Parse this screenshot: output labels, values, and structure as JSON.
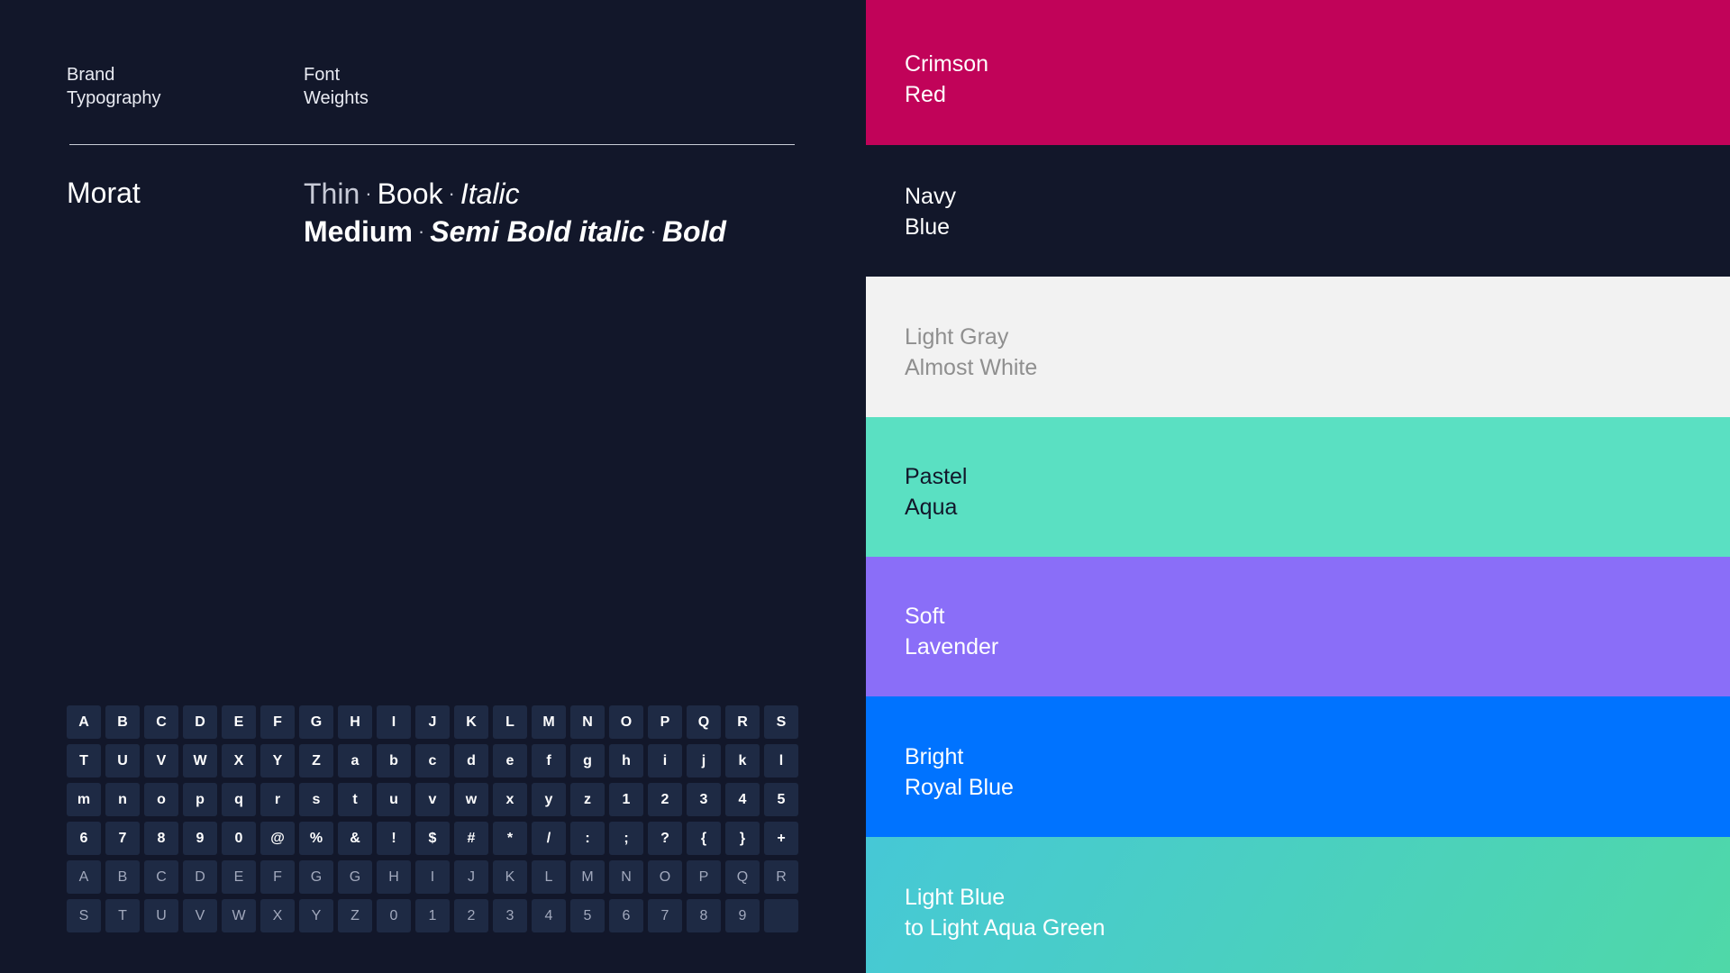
{
  "header": {
    "brand_line1": "Brand",
    "brand_line2": "Typography",
    "font_line1": "Font",
    "font_line2": "Weights"
  },
  "font_name": "Morat",
  "weights": {
    "thin": "Thin",
    "book": "Book",
    "italic": "Italic",
    "medium": "Medium",
    "semibold_italic": "Semi Bold italic",
    "bold": "Bold",
    "separator": "·"
  },
  "glyphs_bold": [
    "A",
    "B",
    "C",
    "D",
    "E",
    "F",
    "G",
    "H",
    "I",
    "J",
    "K",
    "L",
    "M",
    "N",
    "O",
    "P",
    "Q",
    "R",
    "S",
    "T",
    "U",
    "V",
    "W",
    "X",
    "Y",
    "Z",
    "a",
    "b",
    "c",
    "d",
    "e",
    "f",
    "g",
    "h",
    "i",
    "j",
    "k",
    "l",
    "m",
    "n",
    "o",
    "p",
    "q",
    "r",
    "s",
    "t",
    "u",
    "v",
    "w",
    "x",
    "y",
    "z",
    "1",
    "2",
    "3",
    "4",
    "5",
    "6",
    "7",
    "8",
    "9",
    "0",
    "@",
    "%",
    "&",
    "!",
    "$",
    "#",
    "*",
    "/",
    ":",
    ";",
    "?",
    "{",
    "}",
    "+"
  ],
  "glyphs_light": [
    "A",
    "B",
    "C",
    "D",
    "E",
    "F",
    "G",
    "G",
    "H",
    "I",
    "J",
    "K",
    "L",
    "M",
    "N",
    "O",
    "P",
    "Q",
    "R",
    "S",
    "T",
    "U",
    "V",
    "W",
    "X",
    "Y",
    "Z",
    "0",
    "1",
    "2",
    "3",
    "4",
    "5",
    "6",
    "7",
    "8",
    "9",
    ""
  ],
  "swatches": [
    {
      "line1": "Crimson",
      "line2": "Red",
      "color": "#c10359",
      "text_color": "#ffffff"
    },
    {
      "line1": "Navy",
      "line2": "Blue",
      "color": "#12172a",
      "text_color": "#ffffff"
    },
    {
      "line1": "Light Gray",
      "line2": "Almost White",
      "color": "#f2f2f2",
      "text_color": "#8f8f8f"
    },
    {
      "line1": "Pastel",
      "line2": "Aqua",
      "color": "#5ae0c2",
      "text_color": "#12172a"
    },
    {
      "line1": "Soft",
      "line2": "Lavender",
      "color": "#8a6ef8",
      "text_color": "#ffffff"
    },
    {
      "line1": "Bright",
      "line2": "Royal Blue",
      "color": "#0073ff",
      "text_color": "#ffffff"
    },
    {
      "line1": "Light Blue",
      "line2": "to Light Aqua Green",
      "color": "#46c8d6",
      "color_end": "#4fd8a8",
      "text_color": "#ffffff"
    }
  ]
}
